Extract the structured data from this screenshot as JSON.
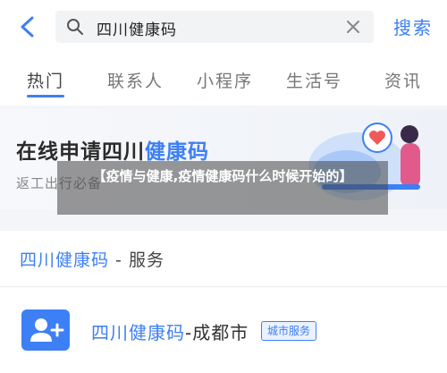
{
  "header": {
    "search_value": "四川健康码",
    "search_button": "搜索"
  },
  "tabs": [
    {
      "label": "热门",
      "active": true
    },
    {
      "label": "联系人",
      "active": false
    },
    {
      "label": "小程序",
      "active": false
    },
    {
      "label": "生活号",
      "active": false
    },
    {
      "label": "资讯",
      "active": false
    }
  ],
  "banner": {
    "title_prefix": "在线申请四川",
    "title_highlight": "健康码",
    "subtitle": "返工出行必备"
  },
  "overlay": {
    "caption": "【疫情与健康,疫情健康码什么时候开始的】"
  },
  "section": {
    "title_highlight": "四川健康码",
    "title_rest": " - 服务"
  },
  "result_item": {
    "title_highlight": "四川健康码",
    "title_rest": "-成都市",
    "badge": "城市服务"
  },
  "colors": {
    "accent": "#3d7ff5",
    "background": "#f3f5f9"
  },
  "icons": [
    "back-arrow-icon",
    "search-icon",
    "clear-icon",
    "user-add-icon"
  ]
}
